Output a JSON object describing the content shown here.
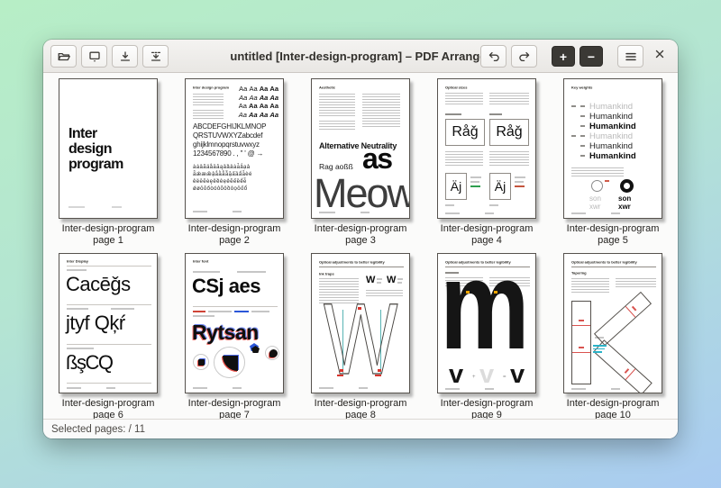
{
  "window": {
    "title": "untitled [Inter-design-program] – PDF Arranger",
    "statusbar": "Selected pages: / 11",
    "zoom_in_glyph": "+",
    "zoom_out_glyph": "−"
  },
  "pages": [
    {
      "caption_line1": "Inter-design-program",
      "caption_line2": "page 1",
      "title_line1": "Inter",
      "title_line2": "design",
      "title_line3": "program"
    },
    {
      "caption_line1": "Inter-design-program",
      "caption_line2": "page 2",
      "heading": "Inter design program",
      "aa": "Aa",
      "alphabet_line1": "ABCDEFGHIJKLMNOP",
      "alphabet_line2": "QRSTUVWXYZabcdef",
      "alphabet_line3": "ghijklmnopqrstuvwxyz",
      "alphabet_line4": "1234567890 . , \" ' @ →",
      "diacritics_line1": "àáâãäåāăąǎȁȃȧǡǻạả",
      "diacritics_line2": "ǟǽæǣậắằẳẵặấầẩẫèé",
      "diacritics_line3": "êëēĕėęěȅȇẹẻẽếềểễ",
      "diacritics_line4": "ǿøōŏőòóôõöȍȏọỏốổ"
    },
    {
      "caption_line1": "Inter-design-program",
      "caption_line2": "page 3",
      "heading": "Aesthetic",
      "line1": "Alternative Neutrality",
      "line2": "Rag aoßß",
      "big": "as",
      "huge": "Meow"
    },
    {
      "caption_line1": "Inter-design-program",
      "caption_line2": "page 4",
      "heading": "Optical sizes",
      "sample_large": "Råǧ",
      "sample_small": "Äj"
    },
    {
      "caption_line1": "Inter-design-program",
      "caption_line2": "page 5",
      "heading": "Key weights",
      "word": "Humankind",
      "o": "O",
      "label1": "son",
      "label2": "xwr"
    },
    {
      "caption_line1": "Inter-design-program",
      "caption_line2": "page 6",
      "heading": "Inter Display",
      "line1": "Cacēǧs",
      "line2": "jtyf Qķŕ",
      "line3": "ßşCQ"
    },
    {
      "caption_line1": "Inter-design-program",
      "caption_line2": "page 7",
      "heading": "Inter font",
      "line1": "CSj aes",
      "line2": "Rytsan"
    },
    {
      "caption_line1": "Inter-design-program",
      "caption_line2": "page 8",
      "heading": "Optical adjustments to better legibility",
      "subhead": "Ink traps",
      "sample": "W",
      "big": "W"
    },
    {
      "caption_line1": "Inter-design-program",
      "caption_line2": "page 9",
      "heading": "Optical adjustments to better legibility",
      "big": "m",
      "glyph": "v",
      "plus": "+",
      "equals": "="
    },
    {
      "caption_line1": "Inter-design-program",
      "caption_line2": "page 10",
      "heading": "Optical adjustments to better legibility",
      "subhead": "Tapering"
    }
  ]
}
